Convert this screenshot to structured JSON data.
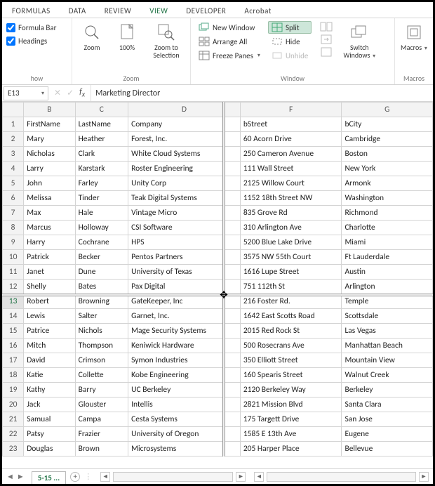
{
  "tabs": {
    "formulas": "FORMULAS",
    "data": "DATA",
    "review": "REVIEW",
    "view": "VIEW",
    "developer": "DEVELOPER",
    "acrobat": "Acrobat"
  },
  "ribbon": {
    "show": {
      "formula_bar": "Formula Bar",
      "headings": "Headings",
      "label": "how"
    },
    "zoom": {
      "zoom": "Zoom",
      "hundred": "100%",
      "to_sel": "Zoom to Selection",
      "label": "Zoom"
    },
    "window": {
      "new_window": "New Window",
      "arrange": "Arrange All",
      "freeze": "Freeze Panes",
      "split": "Split",
      "hide": "Hide",
      "unhide": "Unhide",
      "switch": "Switch Windows",
      "label": "Window"
    },
    "macros": {
      "macros": "Macros",
      "label": "Macros"
    }
  },
  "formula_bar": {
    "cell_ref": "E13",
    "value": "Marketing Director"
  },
  "columns": [
    "B",
    "C",
    "D",
    "F",
    "G"
  ],
  "rows": [
    {
      "n": "1",
      "B": "FirstName",
      "C": "LastName",
      "D": "Company",
      "F": "bStreet",
      "G": "bCity"
    },
    {
      "n": "2",
      "B": "Mary",
      "C": "Heather",
      "D": "Forest, Inc.",
      "F": "60 Acorn Drive",
      "G": "Cambridge"
    },
    {
      "n": "3",
      "B": "Nicholas",
      "C": "Clark",
      "D": "White Cloud Systems",
      "F": "250 Cameron Avenue",
      "G": "Boston"
    },
    {
      "n": "4",
      "B": "Larry",
      "C": "Karstark",
      "D": "Roster Engineering",
      "F": "111 Wall Street",
      "G": "New York"
    },
    {
      "n": "5",
      "B": "John",
      "C": "Farley",
      "D": "Unity Corp",
      "F": "2125 Willow Court",
      "G": "Armonk"
    },
    {
      "n": "6",
      "B": "Melissa",
      "C": "Tinder",
      "D": "Teak Digital Systems",
      "F": "1152 18th Street NW",
      "G": "Washington"
    },
    {
      "n": "7",
      "B": "Max",
      "C": "Hale",
      "D": "Vintage Micro",
      "F": "835 Grove Rd",
      "G": "Richmond"
    },
    {
      "n": "8",
      "B": "Marcus",
      "C": "Holloway",
      "D": "CSI Software",
      "F": "310 Arlington Ave",
      "G": "Charlotte"
    },
    {
      "n": "9",
      "B": "Harry",
      "C": "Cochrane",
      "D": "HPS",
      "F": "5200 Blue Lake Drive",
      "G": "Miami"
    },
    {
      "n": "10",
      "B": "Patrick",
      "C": "Becker",
      "D": "Pentos Partners",
      "F": "3575 NW 55th Court",
      "G": "Ft Lauderdale"
    },
    {
      "n": "11",
      "B": "Janet",
      "C": "Dune",
      "D": "University of Texas",
      "F": "1616 Lupe Street",
      "G": "Austin"
    },
    {
      "n": "12",
      "B": "Shelly",
      "C": "Bates",
      "D": "Pax Digital",
      "F": "751 112th St",
      "G": "Arlington"
    },
    {
      "n": "13",
      "B": "Robert",
      "C": "Browning",
      "D": "GateKeeper, Inc",
      "F": "216 Foster Rd.",
      "G": "Temple"
    },
    {
      "n": "14",
      "B": "Lewis",
      "C": "Salter",
      "D": "Garnet, Inc.",
      "F": "1642 East Scotts Road",
      "G": "Scottsdale"
    },
    {
      "n": "15",
      "B": "Patrice",
      "C": "Nichols",
      "D": "Mage Security Systems",
      "F": "2015 Red Rock St",
      "G": "Las Vegas"
    },
    {
      "n": "16",
      "B": "Mitch",
      "C": "Thompson",
      "D": "Keniwick Hardware",
      "F": "500 Rosecrans Ave",
      "G": "Manhattan Beach"
    },
    {
      "n": "17",
      "B": "David",
      "C": "Crimson",
      "D": "Symon Industries",
      "F": "350 Elliott Street",
      "G": "Mountain View"
    },
    {
      "n": "18",
      "B": "Katie",
      "C": "Collette",
      "D": "Kobe Engineering",
      "F": "160 Spearis Street",
      "G": "Walnut Creek"
    },
    {
      "n": "19",
      "B": "Kathy",
      "C": "Barry",
      "D": "UC Berkeley",
      "F": "2120 Berkeley Way",
      "G": "Berkeley"
    },
    {
      "n": "20",
      "B": "Jack",
      "C": "Glouster",
      "D": "Intellis",
      "F": "2821 Mission Blvd",
      "G": "Santa Clara"
    },
    {
      "n": "21",
      "B": "Samual",
      "C": "Campa",
      "D": "Cesta Systems",
      "F": "175 Targett Drive",
      "G": "San Jose"
    },
    {
      "n": "22",
      "B": "Patsy",
      "C": "Frazier",
      "D": "University of Oregon",
      "F": "1585 E 13th Ave",
      "G": "Eugene"
    },
    {
      "n": "23",
      "B": "Douglas",
      "C": "Brown",
      "D": "Microsystems",
      "F": "205 Harper Place",
      "G": "Bellevue"
    }
  ],
  "active_row": "13",
  "sheet_tab": "5-15 ...",
  "split": {
    "row_after": "12",
    "col_after": "D"
  }
}
